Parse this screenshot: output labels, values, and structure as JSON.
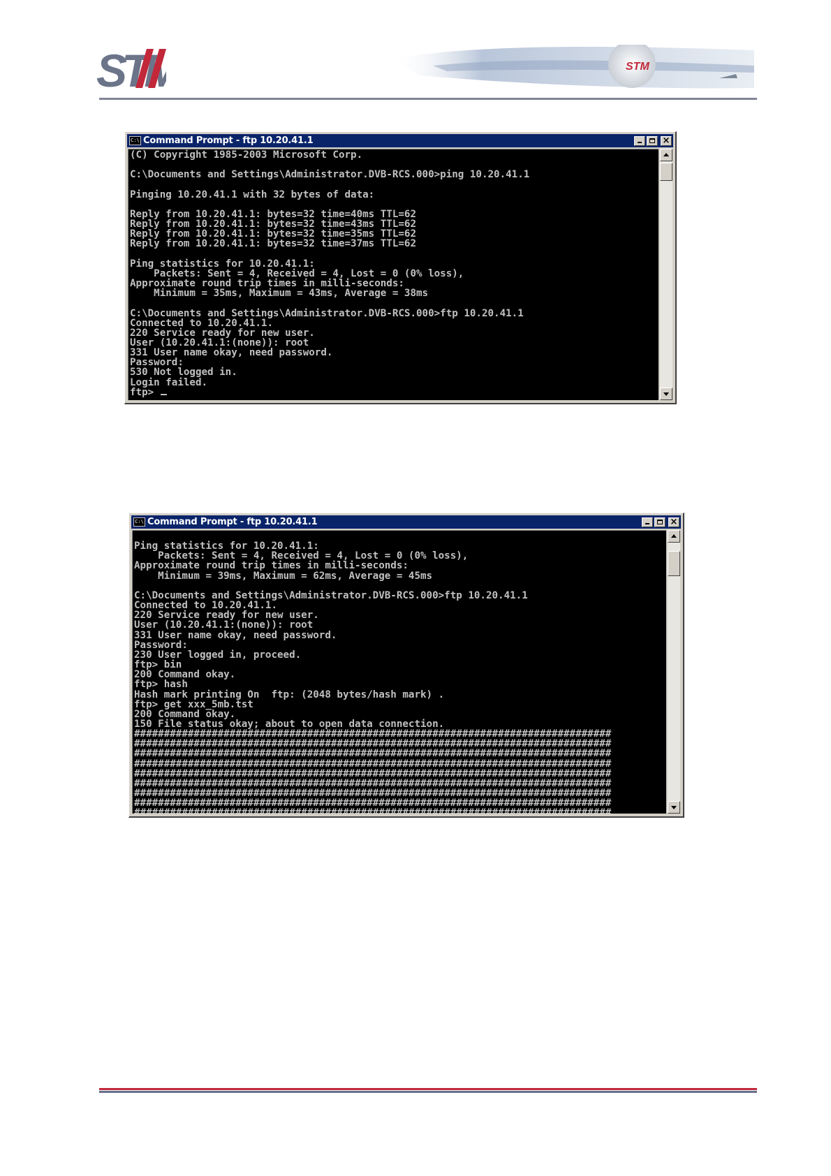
{
  "header": {
    "logo_text": "STM",
    "banner_logo_text": "STM"
  },
  "colors": {
    "titlebar": "#0a246a",
    "console_bg": "#000000",
    "console_fg": "#c0c0c0",
    "logo_gray": "#6b7489",
    "logo_red": "#c2283a"
  },
  "window1": {
    "title": "Command Prompt - ftp 10.20.41.1",
    "icon_label": "C:\\",
    "lines": [
      "(C) Copyright 1985-2003 Microsoft Corp.",
      "",
      "C:\\Documents and Settings\\Administrator.DVB-RCS.000>ping 10.20.41.1",
      "",
      "Pinging 10.20.41.1 with 32 bytes of data:",
      "",
      "Reply from 10.20.41.1: bytes=32 time=40ms TTL=62",
      "Reply from 10.20.41.1: bytes=32 time=43ms TTL=62",
      "Reply from 10.20.41.1: bytes=32 time=35ms TTL=62",
      "Reply from 10.20.41.1: bytes=32 time=37ms TTL=62",
      "",
      "Ping statistics for 10.20.41.1:",
      "    Packets: Sent = 4, Received = 4, Lost = 0 (0% loss),",
      "Approximate round trip times in milli-seconds:",
      "    Minimum = 35ms, Maximum = 43ms, Average = 38ms",
      "",
      "C:\\Documents and Settings\\Administrator.DVB-RCS.000>ftp 10.20.41.1",
      "Connected to 10.20.41.1.",
      "220 Service ready for new user.",
      "User (10.20.41.1:(none)): root",
      "331 User name okay, need password.",
      "Password:",
      "530 Not logged in.",
      "Login failed.",
      "ftp> "
    ]
  },
  "window2": {
    "title": "Command Prompt - ftp 10.20.41.1",
    "icon_label": "C:\\",
    "lines": [
      "",
      "Ping statistics for 10.20.41.1:",
      "    Packets: Sent = 4, Received = 4, Lost = 0 (0% loss),",
      "Approximate round trip times in milli-seconds:",
      "    Minimum = 39ms, Maximum = 62ms, Average = 45ms",
      "",
      "C:\\Documents and Settings\\Administrator.DVB-RCS.000>ftp 10.20.41.1",
      "Connected to 10.20.41.1.",
      "220 Service ready for new user.",
      "User (10.20.41.1:(none)): root",
      "331 User name okay, need password.",
      "Password:",
      "230 User logged in, proceed.",
      "ftp> bin",
      "200 Command okay.",
      "ftp> hash",
      "Hash mark printing On  ftp: (2048 bytes/hash mark) .",
      "ftp> get xxx_5mb.tst",
      "200 Command okay.",
      "150 File status okay; about to open data connection.",
      "################################################################################",
      "################################################################################",
      "################################################################################",
      "################################################################################",
      "################################################################################",
      "################################################################################",
      "################################################################################",
      "################################################################################",
      "################################################################################"
    ]
  }
}
